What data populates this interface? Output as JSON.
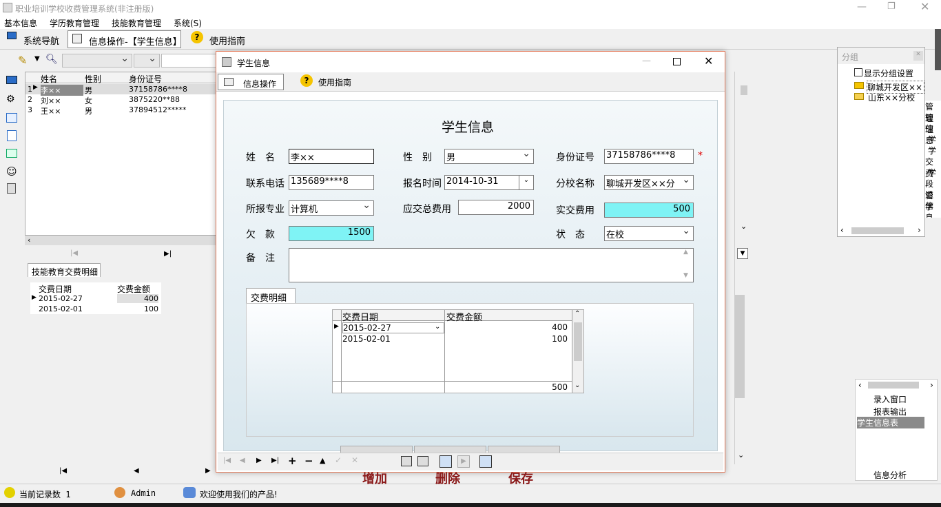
{
  "app": {
    "title": "职业培训学校收费管理系统(非注册版)"
  },
  "menu": [
    "基本信息",
    "学历教育管理",
    "技能教育管理",
    "系统(S)"
  ],
  "tabs": [
    "系统导航",
    "信息操作-【学生信息】",
    "使用指南"
  ],
  "students": {
    "headers": [
      "姓名",
      "性别",
      "身份证号"
    ],
    "rows": [
      {
        "no": "1",
        "name": "李××",
        "gender": "男",
        "id": "37158786****8"
      },
      {
        "no": "2",
        "name": "刘××",
        "gender": "女",
        "id": "3875220**88"
      },
      {
        "no": "3",
        "name": "王××",
        "gender": "男",
        "id": "37894512*****"
      }
    ]
  },
  "left_tab": "技能教育交费明细",
  "left_pay": {
    "headers": [
      "交费日期",
      "交费金额"
    ],
    "rows": [
      [
        "2015-02-27",
        "400"
      ],
      [
        "2015-02-01",
        "100"
      ]
    ]
  },
  "dialog": {
    "title": "学生信息",
    "tab1": "信息操作",
    "tab2": "使用指南",
    "heading": "学生信息",
    "labels": {
      "name": "姓　名",
      "gender": "性　别",
      "id": "身份证号",
      "phone": "联系电话",
      "regtime": "报名时间",
      "branch": "分校名称",
      "major": "所报专业",
      "total": "应交总费用",
      "paid": "实交费用",
      "owe": "欠　款",
      "status": "状　态",
      "remark": "备　注"
    },
    "values": {
      "name": "李××",
      "gender": "男",
      "id": "37158786****8",
      "phone": "135689****8",
      "regtime": "2014-10-31",
      "branch": "聊城开发区××分",
      "major": "计算机",
      "total": "2000",
      "paid": "500",
      "owe": "1500",
      "status": "在校"
    },
    "required": "*",
    "detail_tab": "交费明细",
    "detail_headers": [
      "交费日期",
      "交费金额"
    ],
    "detail_rows": [
      [
        "2015-02-27",
        "400"
      ],
      [
        "2015-02-01",
        "100"
      ]
    ],
    "detail_sum": "500",
    "buttons": {
      "add": "增加",
      "del": "删除",
      "save": "保存"
    }
  },
  "group": {
    "title": "分组",
    "show": "显示分组设置",
    "items": [
      "聊城开发区××",
      "山东××分校"
    ]
  },
  "right_partial": [
    "管理",
    "管理",
    "信息",
    "学",
    "学",
    "交费",
    "学",
    "段管",
    "退学",
    "信息"
  ],
  "right_menu": [
    "录入窗口",
    "报表输出",
    "学生信息表"
  ],
  "right_bottom": "信息分析",
  "status": {
    "record": "当前记录数 1",
    "user": "Admin",
    "welcome": "欢迎使用我们的产品!"
  }
}
